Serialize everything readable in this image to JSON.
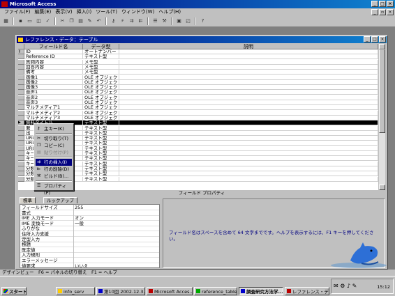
{
  "app": {
    "title": "Microsoft Access"
  },
  "menu": [
    "ファイル(F)",
    "編集(E)",
    "表示(V)",
    "挿入(I)",
    "ツール(T)",
    "ウィンドウ(W)",
    "ヘルプ(H)"
  ],
  "window": {
    "title": "レファレンス・データ：テーブル"
  },
  "grid": {
    "headers": {
      "field": "フィールド名",
      "type": "データ型",
      "desc": "説明"
    },
    "rows": [
      {
        "field": "ID",
        "type": "オートナンバー"
      },
      {
        "field": "Reference ID",
        "type": "テキスト型"
      },
      {
        "field": "質問内容",
        "type": "メモ型"
      },
      {
        "field": "回答内容",
        "type": "メモ型"
      },
      {
        "field": "備考",
        "type": "メモ型"
      },
      {
        "field": "画像1",
        "type": "OLE オブジェクト"
      },
      {
        "field": "画像2",
        "type": "OLE オブジェクト"
      },
      {
        "field": "画像3",
        "type": "OLE オブジェクト"
      },
      {
        "field": "音声1",
        "type": "OLE オブジェクト"
      },
      {
        "field": "音声2",
        "type": "OLE オブジェクト"
      },
      {
        "field": "音声3",
        "type": "OLE オブジェクト"
      },
      {
        "field": "マルチメディア1",
        "type": "OLE オブジェクト"
      },
      {
        "field": "マルチメディア2",
        "type": "OLE オブジェクト"
      },
      {
        "field": "マルチメディア3",
        "type": "OLE オブジェクト"
      },
      {
        "field": "資料タイトル",
        "type": "テキスト型"
      },
      {
        "field": "著",
        "type": "テキスト型"
      },
      {
        "field": "出",
        "type": "テキスト型"
      },
      {
        "field": "URL",
        "type": "テキスト型"
      },
      {
        "field": "URL",
        "type": "テキスト型"
      },
      {
        "field": "URL",
        "type": "テキスト型"
      },
      {
        "field": "キー",
        "type": "テキスト型"
      },
      {
        "field": "キー",
        "type": "テキスト型"
      },
      {
        "field": "キー",
        "type": "テキスト型"
      },
      {
        "field": "分類",
        "type": "テキスト型"
      },
      {
        "field": "分類",
        "type": "テキスト型"
      },
      {
        "field": "分類",
        "type": "テキスト型"
      }
    ]
  },
  "context_menu": {
    "primary_key": "主キー(K)",
    "cut": "切り取り(T)",
    "copy": "コピー(C)",
    "paste": "貼り付け(P)",
    "insert_row": "行の挿入(I)",
    "delete_row": "行の削除(D)",
    "build": "ビルド(B)...",
    "properties": "プロパティ(P)"
  },
  "field_props": {
    "label": "フィールド プロパティ",
    "tabs": [
      "標準",
      "ルックアップ"
    ],
    "rows": [
      {
        "name": "フィールドサイズ",
        "value": "255"
      },
      {
        "name": "書式",
        "value": ""
      },
      {
        "name": "IME 入力モード",
        "value": "オン"
      },
      {
        "name": "IME 変換モード",
        "value": "一般"
      },
      {
        "name": "ふりがな",
        "value": ""
      },
      {
        "name": "住所入力支援",
        "value": ""
      },
      {
        "name": "定型入力",
        "value": ""
      },
      {
        "name": "標題",
        "value": ""
      },
      {
        "name": "既定値",
        "value": ""
      },
      {
        "name": "入力規則",
        "value": ""
      },
      {
        "name": "エラーメッセージ",
        "value": ""
      },
      {
        "name": "値要求",
        "value": "いいえ"
      }
    ],
    "help": "フィールド名はスペースを含めて 64 文字までです。ヘルプを表示するには、F1 キーを押してください。"
  },
  "status": "デザインビュー　F6 = パネルの切り替え　F1 = ヘルプ",
  "taskbar": {
    "start": "スタート",
    "buttons": [
      "info_serv",
      "第10回 2002.12.3...",
      "Microsoft Acces...",
      "reference_table_...",
      "調査研究方法学...",
      "レファレンス・データ..."
    ],
    "time": "15:12"
  },
  "colors": {
    "title_active": "#000080",
    "selection": "#000000",
    "help_text": "#000080"
  }
}
